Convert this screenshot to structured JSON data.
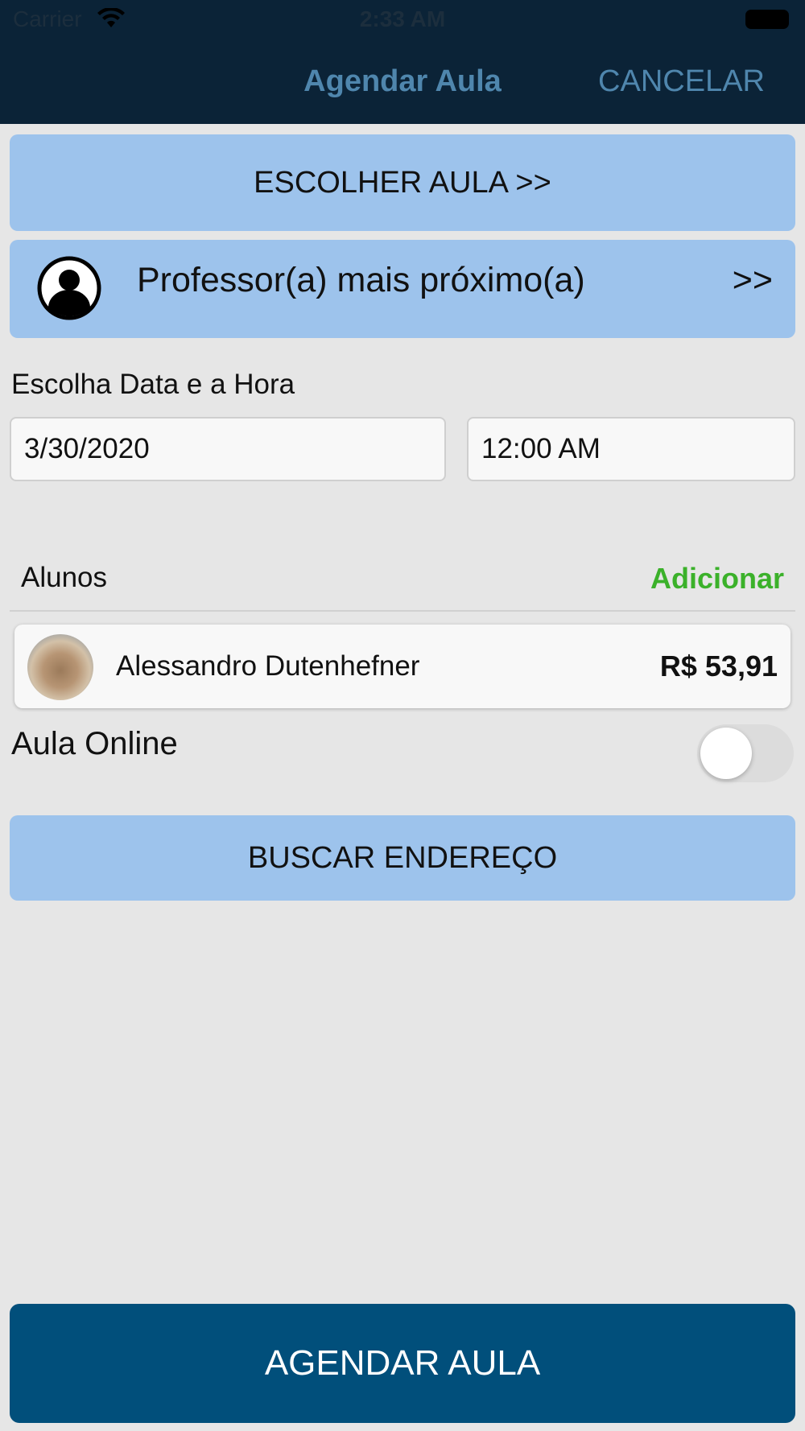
{
  "status_bar": {
    "carrier": "Carrier",
    "time": "2:33 AM"
  },
  "nav": {
    "title": "Agendar Aula",
    "cancel_label": "CANCELAR"
  },
  "buttons": {
    "escolher_aula": "ESCOLHER AULA >>",
    "buscar_endereco": "BUSCAR ENDEREÇO",
    "agendar_aula": "AGENDAR AULA"
  },
  "professor": {
    "label": "Professor(a) mais próximo(a)",
    "arrow": ">>"
  },
  "datetime": {
    "label": "Escolha Data e a Hora",
    "date": "3/30/2020",
    "time": "12:00 AM"
  },
  "alunos": {
    "label": "Alunos",
    "add_label": "Adicionar",
    "items": [
      {
        "name": "Alessandro Dutenhefner",
        "price": "R$ 53,91"
      }
    ]
  },
  "online": {
    "label": "Aula Online",
    "enabled": false
  },
  "colors": {
    "header_bg": "#0b2337",
    "nav_text": "#4f86ad",
    "button_light": "#9dc3ec",
    "accent_green": "#3bb12a",
    "primary_button": "#014f7b",
    "background": "#e6e6e6"
  }
}
